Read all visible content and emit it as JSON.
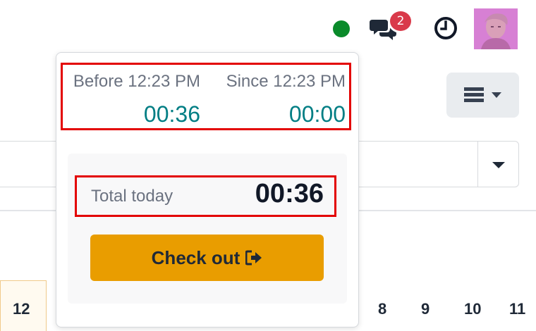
{
  "topbar": {
    "status_color": "#0a8a2a",
    "chat_badge_count": "2",
    "icons": [
      "presence-dot",
      "chat-icon",
      "clock-icon",
      "user-avatar"
    ]
  },
  "attendance": {
    "before_label": "Before 12:23 PM",
    "before_value": "00:36",
    "since_label": "Since 12:23 PM",
    "since_value": "00:00",
    "total_label": "Total today",
    "total_value": "00:36",
    "checkout_label": "Check out",
    "checkout_icon": "sign-out-icon",
    "accent_color": "#017e84",
    "button_color": "#e99d00",
    "highlight_color": "#e30000"
  },
  "calendar": {
    "days": [
      "12",
      "8",
      "9",
      "10",
      "11"
    ]
  }
}
